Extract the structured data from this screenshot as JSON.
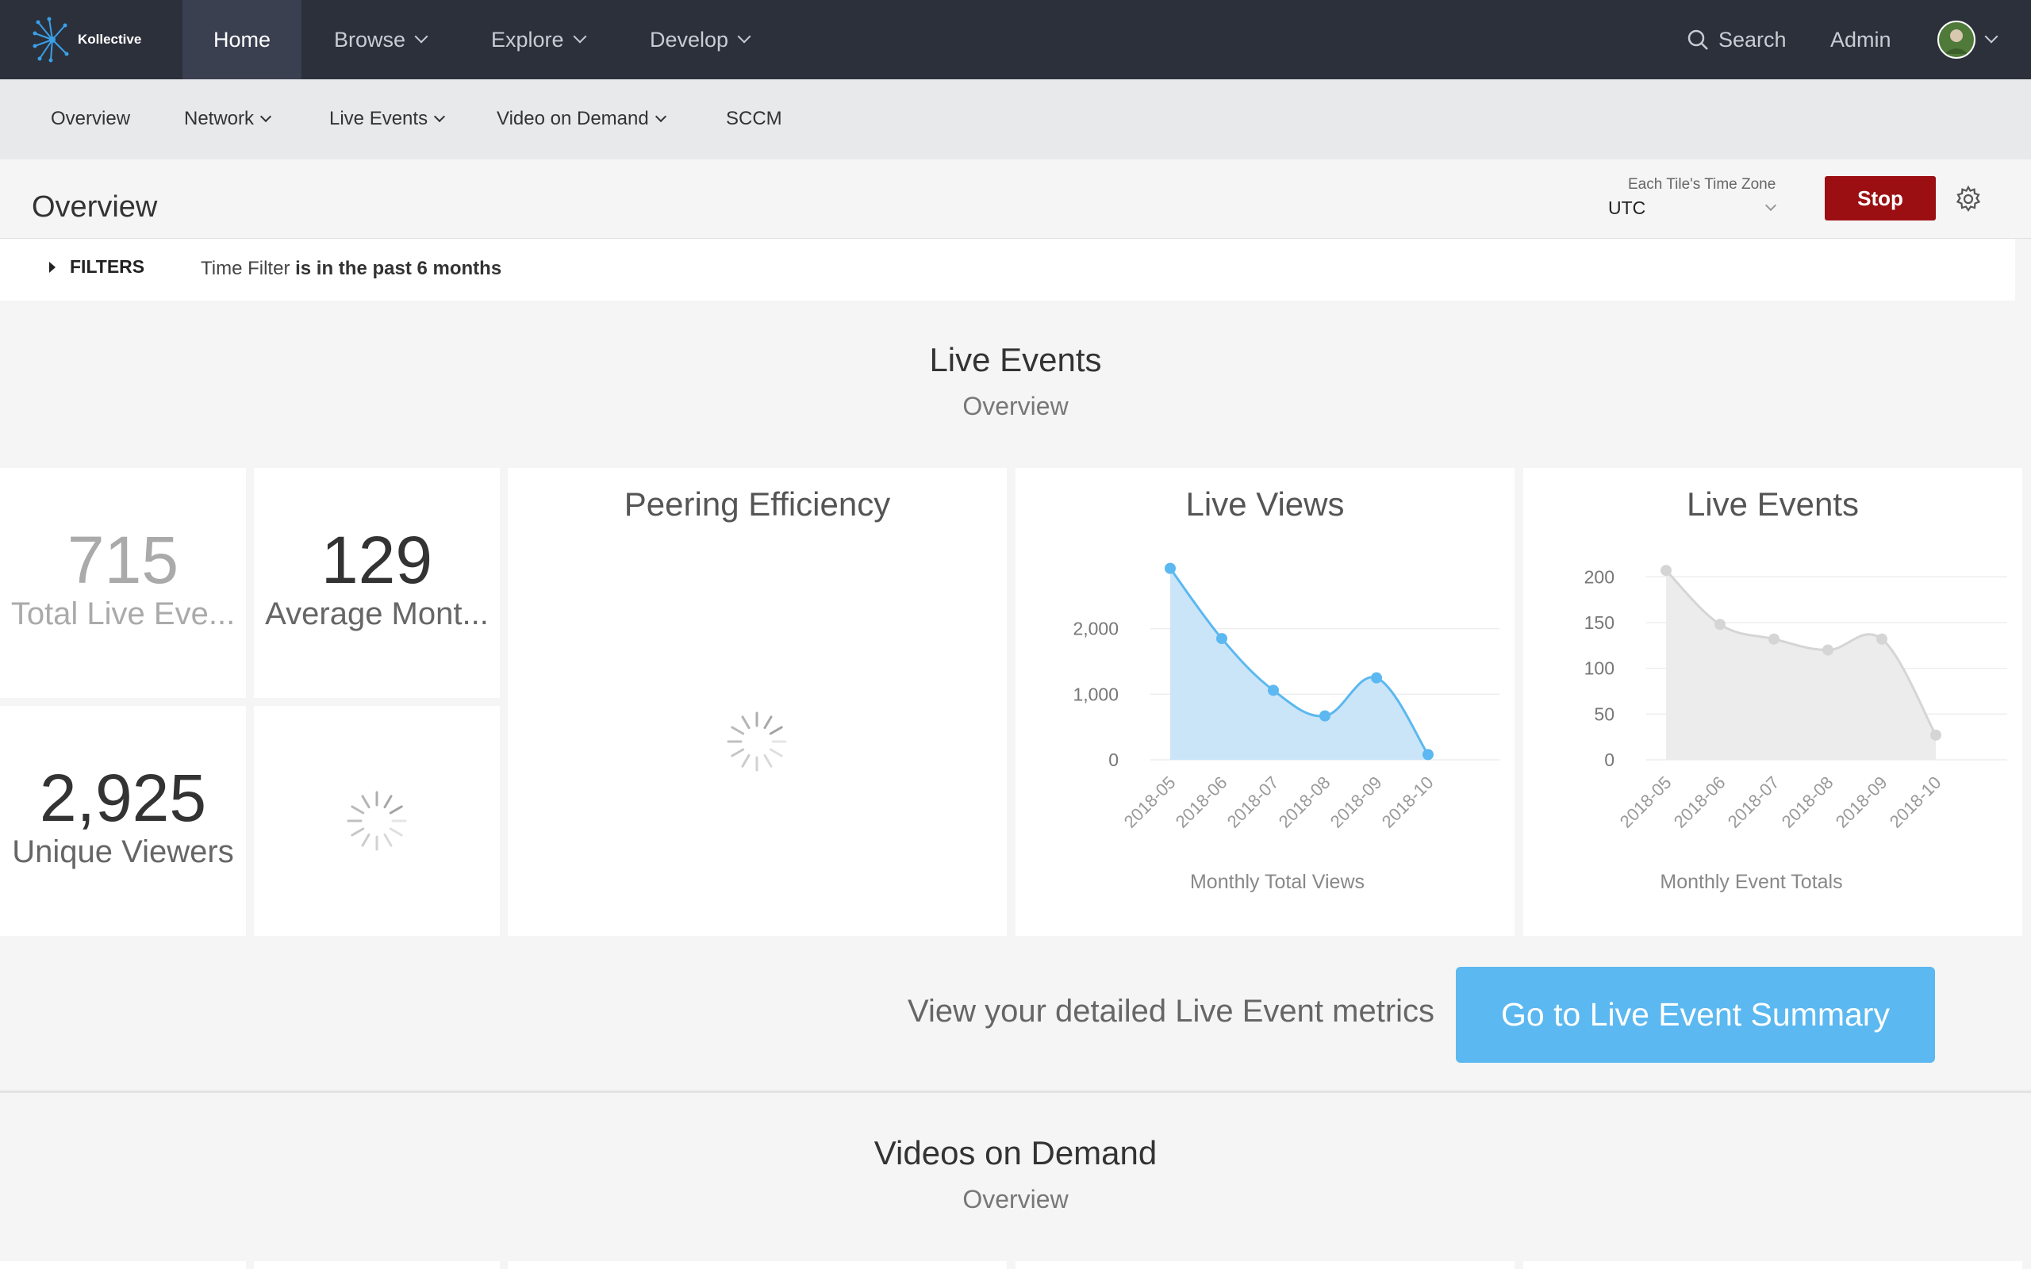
{
  "topnav": {
    "brand": "Kollective",
    "items": [
      {
        "label": "Home"
      },
      {
        "label": "Browse"
      },
      {
        "label": "Explore"
      },
      {
        "label": "Develop"
      }
    ],
    "search_label": "Search",
    "admin_label": "Admin"
  },
  "subnav": {
    "items": [
      {
        "label": "Overview"
      },
      {
        "label": "Network"
      },
      {
        "label": "Live Events"
      },
      {
        "label": "Video on Demand"
      },
      {
        "label": "SCCM"
      }
    ]
  },
  "page": {
    "title": "Overview",
    "timezone_label": "Each Tile's Time Zone",
    "timezone_value": "UTC",
    "stop_label": "Stop"
  },
  "filters": {
    "toggle_label": "FILTERS",
    "desc_prefix": "Time Filter",
    "desc_value": "is in the past 6 months"
  },
  "live_section": {
    "title": "Live Events",
    "subtitle": "Overview"
  },
  "stats": {
    "total_live_events": {
      "value": "715",
      "label": "Total Live Eve..."
    },
    "average_monthly": {
      "value": "129",
      "label": "Average Mont..."
    },
    "unique_viewers": {
      "value": "2,925",
      "label": "Unique Viewers"
    }
  },
  "tiles": {
    "peering_title": "Peering Efficiency",
    "live_views_title": "Live Views",
    "live_events_title": "Live Events"
  },
  "chart_data": [
    {
      "type": "area",
      "title": "Live Views",
      "xlabel": "Monthly Total Views",
      "ylabel": "",
      "categories": [
        "2018-05",
        "2018-06",
        "2018-07",
        "2018-08",
        "2018-09",
        "2018-10"
      ],
      "values": [
        2920,
        1850,
        1060,
        670,
        1250,
        80
      ],
      "yticks": [
        0,
        1000,
        2000
      ],
      "ytick_labels": [
        "0",
        "1,000",
        "2,000"
      ],
      "ylim": [
        0,
        3000
      ],
      "color": "#5bb8f0",
      "fill": "#cbe5f8",
      "grid": true
    },
    {
      "type": "area",
      "title": "Live Events",
      "xlabel": "Monthly Event Totals",
      "ylabel": "",
      "categories": [
        "2018-05",
        "2018-06",
        "2018-07",
        "2018-08",
        "2018-09",
        "2018-10"
      ],
      "values": [
        207,
        148,
        132,
        120,
        132,
        27
      ],
      "yticks": [
        0,
        50,
        100,
        150,
        200
      ],
      "ytick_labels": [
        "0",
        "50",
        "100",
        "150",
        "200"
      ],
      "ylim": [
        0,
        215
      ],
      "color": "#d5d5d5",
      "fill": "#ececec",
      "grid": true
    }
  ],
  "cta": {
    "text": "View your detailed Live Event metrics",
    "button_label": "Go to Live Event Summary"
  },
  "vod_section": {
    "title": "Videos on Demand",
    "subtitle": "Overview"
  }
}
